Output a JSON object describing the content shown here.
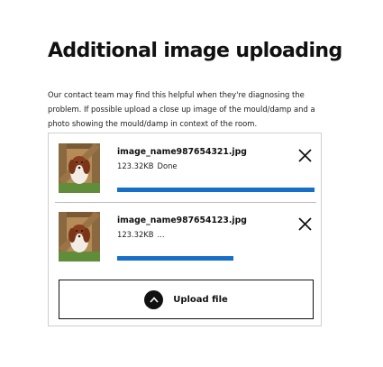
{
  "page": {
    "title": "Additional image uploading",
    "description": "Our contact team may find this helpful when they're diagnosing the problem. If possible upload a close up image of the mould/damp and a photo showing the mould/damp in context of the room."
  },
  "uploads": [
    {
      "name": "image_name987654321.jpg",
      "size": "123.32KB",
      "status": "Done",
      "progress": 1.0
    },
    {
      "name": "image_name987654123.jpg",
      "size": "123.32KB",
      "status": "...",
      "progress": 0.59
    }
  ],
  "upload_button": {
    "label": "Upload file",
    "icon": "chevron-up-icon"
  },
  "icons": {
    "remove": "close-icon",
    "thumbnail": "dog-photo-thumbnail"
  },
  "colors": {
    "accent": "#1670c8",
    "text": "#111111",
    "border": "#cfcfcf"
  }
}
